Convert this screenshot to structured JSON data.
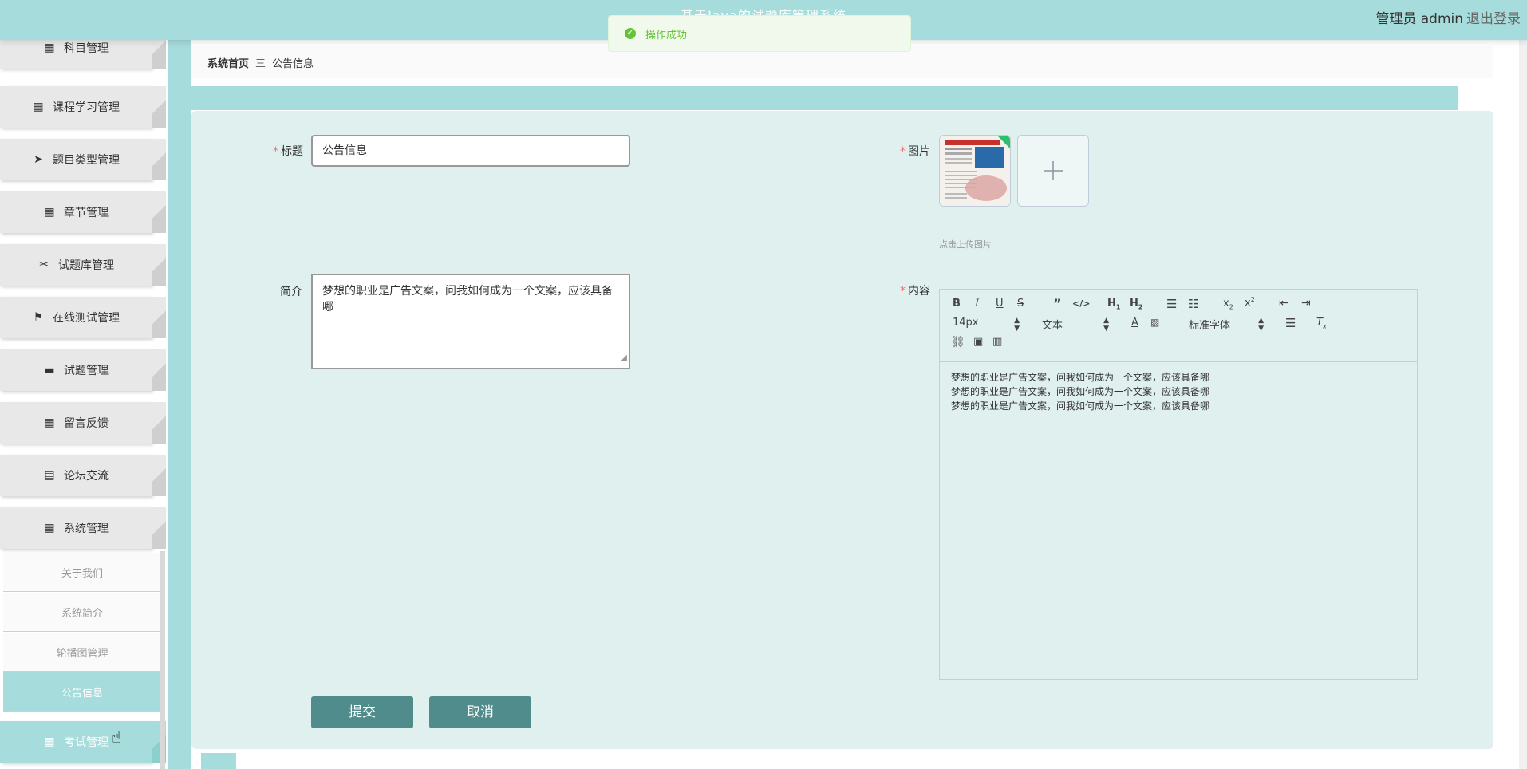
{
  "header": {
    "system_title": "基于Java的试题库管理系统",
    "user_label": "管理员 admin",
    "logout_label": "退出登录"
  },
  "toast": {
    "message": "操作成功"
  },
  "sidebar": {
    "items": [
      {
        "label": "科目管理",
        "icon": "grid-icon"
      },
      {
        "label": "课程学习管理",
        "icon": "grid-icon"
      },
      {
        "label": "题目类型管理",
        "icon": "paper-plane-icon"
      },
      {
        "label": "章节管理",
        "icon": "grid-icon"
      },
      {
        "label": "试题库管理",
        "icon": "ticket-icon"
      },
      {
        "label": "在线测试管理",
        "icon": "flag-icon"
      },
      {
        "label": "试题管理",
        "icon": "monitor-icon"
      },
      {
        "label": "留言反馈",
        "icon": "grid-icon"
      },
      {
        "label": "论坛交流",
        "icon": "clipboard-icon"
      },
      {
        "label": "系统管理",
        "icon": "grid-icon"
      }
    ],
    "submenu": [
      {
        "label": "关于我们"
      },
      {
        "label": "系统简介"
      },
      {
        "label": "轮播图管理"
      },
      {
        "label": "公告信息"
      }
    ],
    "last_item": {
      "label": "考试管理",
      "icon": "grid-icon"
    }
  },
  "breadcrumb": {
    "home": "系统首页",
    "separator": "三",
    "current": "公告信息"
  },
  "form": {
    "title_label": "标题",
    "title_value": "公告信息",
    "intro_label": "简介",
    "intro_value": "梦想的职业是广告文案，问我如何成为一个文案，应该具备哪",
    "image_label": "图片",
    "upload_hint": "点击上传图片",
    "content_label": "内容",
    "submit_label": "提交",
    "cancel_label": "取消"
  },
  "editor": {
    "font_size": "14px",
    "header_select": "文本",
    "font_family": "标准字体",
    "content_lines": [
      "梦想的职业是广告文案，问我如何成为一个文案，应该具备哪",
      "梦想的职业是广告文案，问我如何成为一个文案，应该具备哪",
      "梦想的职业是广告文案，问我如何成为一个文案，应该具备哪"
    ]
  },
  "colors": {
    "theme": "#a6dcdb",
    "button": "#4f8c8b",
    "card": "#dff0ef",
    "success": "#67c23a",
    "required": "#f56c6c"
  }
}
